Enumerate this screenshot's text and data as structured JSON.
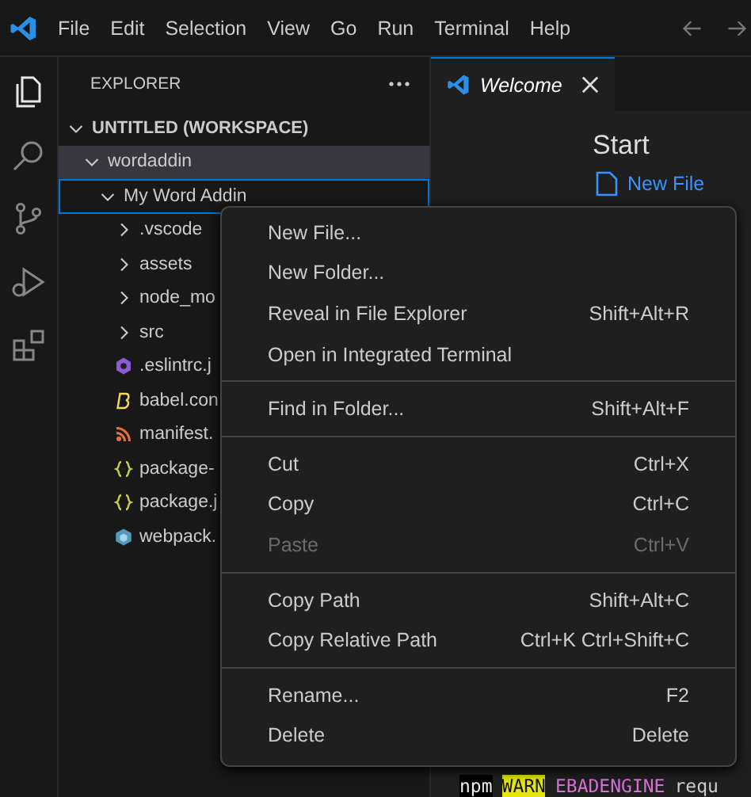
{
  "menubar": {
    "items": [
      "File",
      "Edit",
      "Selection",
      "View",
      "Go",
      "Run",
      "Terminal",
      "Help"
    ]
  },
  "activity_bar": [
    {
      "kind": "files",
      "selected": true
    },
    {
      "kind": "search",
      "selected": false
    },
    {
      "kind": "source-control",
      "selected": false
    },
    {
      "kind": "run-debug",
      "selected": false
    },
    {
      "kind": "extensions",
      "selected": false
    }
  ],
  "sidebar": {
    "title": "EXPLORER",
    "tree": [
      {
        "label": "UNTITLED (WORKSPACE)",
        "kind": "root",
        "expanded": true,
        "selected": false,
        "focused": false,
        "children": [
          {
            "label": "wordaddin",
            "kind": "folder",
            "expanded": true,
            "selected": true,
            "focused": false,
            "children": [
              {
                "label": "My Word Addin",
                "kind": "folder",
                "expanded": true,
                "selected": false,
                "focused": true,
                "children": [
                  {
                    "label": ".vscode",
                    "kind": "folder",
                    "expanded": false,
                    "selected": false,
                    "focused": false
                  },
                  {
                    "label": "assets",
                    "kind": "folder",
                    "expanded": false,
                    "selected": false,
                    "focused": false
                  },
                  {
                    "label": "node_mo",
                    "kind": "folder",
                    "expanded": false,
                    "selected": false,
                    "focused": false
                  },
                  {
                    "label": "src",
                    "kind": "folder",
                    "expanded": false,
                    "selected": false,
                    "focused": false
                  },
                  {
                    "label": ".eslintrc.j",
                    "kind": "eslint",
                    "selected": false,
                    "focused": false
                  },
                  {
                    "label": "babel.con",
                    "kind": "babel",
                    "selected": false,
                    "focused": false
                  },
                  {
                    "label": "manifest.",
                    "kind": "rss",
                    "selected": false,
                    "focused": false
                  },
                  {
                    "label": "package-",
                    "kind": "json",
                    "selected": false,
                    "focused": false
                  },
                  {
                    "label": "package.j",
                    "kind": "json",
                    "selected": false,
                    "focused": false
                  },
                  {
                    "label": "webpack.",
                    "kind": "webpack",
                    "selected": false,
                    "focused": false
                  }
                ]
              }
            ]
          }
        ]
      }
    ]
  },
  "tabs": [
    {
      "label": "Welcome",
      "selected": true
    }
  ],
  "welcome": {
    "title": "Start",
    "link": "New File"
  },
  "terminal": [
    {
      "text": "npm",
      "kind": "inverse"
    },
    {
      "text": "WARN",
      "kind": "warn"
    },
    {
      "text": "EBADENGINE",
      "kind": "code"
    },
    {
      "text": "requ",
      "kind": "plain"
    }
  ],
  "context_menu": [
    [
      {
        "label": "New File...",
        "disabled": false
      },
      {
        "label": "New Folder...",
        "disabled": false
      },
      {
        "label": "Reveal in File Explorer",
        "shortcut": "Shift+Alt+R",
        "disabled": false
      },
      {
        "label": "Open in Integrated Terminal",
        "disabled": false
      }
    ],
    [
      {
        "label": "Find in Folder...",
        "shortcut": "Shift+Alt+F",
        "disabled": false
      }
    ],
    [
      {
        "label": "Cut",
        "shortcut": "Ctrl+X",
        "disabled": false
      },
      {
        "label": "Copy",
        "shortcut": "Ctrl+C",
        "disabled": false
      },
      {
        "label": "Paste",
        "shortcut": "Ctrl+V",
        "disabled": true
      }
    ],
    [
      {
        "label": "Copy Path",
        "shortcut": "Shift+Alt+C",
        "disabled": false
      },
      {
        "label": "Copy Relative Path",
        "shortcut": "Ctrl+K Ctrl+Shift+C",
        "disabled": false
      }
    ],
    [
      {
        "label": "Rename...",
        "shortcut": "F2",
        "disabled": false
      },
      {
        "label": "Delete",
        "shortcut": "Delete",
        "disabled": false
      }
    ]
  ]
}
